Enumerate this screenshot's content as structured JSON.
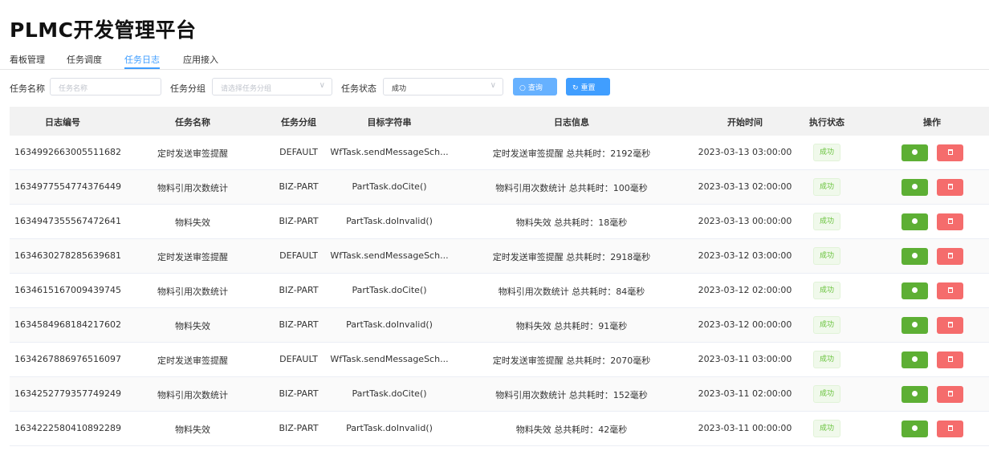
{
  "app": {
    "title": "PLMC开发管理平台"
  },
  "tabs": [
    {
      "label": "看板管理",
      "active": false
    },
    {
      "label": "任务调度",
      "active": false
    },
    {
      "label": "任务日志",
      "active": true
    },
    {
      "label": "应用接入",
      "active": false
    }
  ],
  "search": {
    "task_name_label": "任务名称",
    "task_name_placeholder": "任务名称",
    "task_group_label": "任务分组",
    "task_group_placeholder": "请选择任务分组",
    "task_status_label": "任务状态",
    "task_status_value": "成功",
    "query_button": "查询",
    "reset_button": "重置"
  },
  "table": {
    "headers": [
      "日志编号",
      "任务名称",
      "任务分组",
      "目标字符串",
      "日志信息",
      "开始时间",
      "执行状态",
      "操作"
    ],
    "rows": [
      {
        "id": "1634992663005511682",
        "name": "定时发送审签提醒",
        "group": "DEFAULT",
        "target": "WfTask.sendMessageSch...",
        "info": "定时发送审签提醒 总共耗时：2192毫秒",
        "start": "2023-03-13 03:00:00",
        "status": "成功"
      },
      {
        "id": "1634977554774376449",
        "name": "物料引用次数统计",
        "group": "BIZ-PART",
        "target": "PartTask.doCite()",
        "info": "物料引用次数统计 总共耗时：100毫秒",
        "start": "2023-03-13 02:00:00",
        "status": "成功"
      },
      {
        "id": "1634947355567472641",
        "name": "物料失效",
        "group": "BIZ-PART",
        "target": "PartTask.doInvalid()",
        "info": "物料失效 总共耗时：18毫秒",
        "start": "2023-03-13 00:00:00",
        "status": "成功"
      },
      {
        "id": "1634630278285639681",
        "name": "定时发送审签提醒",
        "group": "DEFAULT",
        "target": "WfTask.sendMessageSch...",
        "info": "定时发送审签提醒 总共耗时：2918毫秒",
        "start": "2023-03-12 03:00:00",
        "status": "成功"
      },
      {
        "id": "1634615167009439745",
        "name": "物料引用次数统计",
        "group": "BIZ-PART",
        "target": "PartTask.doCite()",
        "info": "物料引用次数统计 总共耗时：84毫秒",
        "start": "2023-03-12 02:00:00",
        "status": "成功"
      },
      {
        "id": "1634584968184217602",
        "name": "物料失效",
        "group": "BIZ-PART",
        "target": "PartTask.doInvalid()",
        "info": "物料失效 总共耗时：91毫秒",
        "start": "2023-03-12 00:00:00",
        "status": "成功"
      },
      {
        "id": "1634267886976516097",
        "name": "定时发送审签提醒",
        "group": "DEFAULT",
        "target": "WfTask.sendMessageSch...",
        "info": "定时发送审签提醒 总共耗时：2070毫秒",
        "start": "2023-03-11 03:00:00",
        "status": "成功"
      },
      {
        "id": "1634252779357749249",
        "name": "物料引用次数统计",
        "group": "BIZ-PART",
        "target": "PartTask.doCite()",
        "info": "物料引用次数统计 总共耗时：152毫秒",
        "start": "2023-03-11 02:00:00",
        "status": "成功"
      },
      {
        "id": "1634222580410892289",
        "name": "物料失效",
        "group": "BIZ-PART",
        "target": "PartTask.doInvalid()",
        "info": "物料失效 总共耗时：42毫秒",
        "start": "2023-03-11 00:00:00",
        "status": "成功"
      }
    ]
  },
  "icons": {
    "view": "info-icon",
    "delete": "trash-icon",
    "query": "search-icon",
    "reset": "refresh-icon",
    "select": "chevron-down-icon"
  },
  "colors": {
    "accent": "#409eff",
    "success": "#67c23a",
    "view_button": "#5daf34",
    "delete_button": "#f56c6c"
  }
}
